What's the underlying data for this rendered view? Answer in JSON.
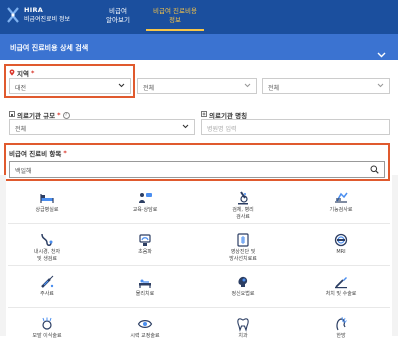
{
  "header": {
    "logo_line1": "HIRA",
    "logo_line2": "비급여진료비 정보",
    "nav": [
      {
        "line1": "비급여",
        "line2": "알아보기"
      },
      {
        "line1": "비급여 진료비용",
        "line2": "정보"
      }
    ]
  },
  "panel": {
    "title": "비급여 진료비용 상세 검색"
  },
  "region": {
    "label": "지역",
    "required": "*",
    "sido": "대전",
    "sigungu": "전체",
    "dong": "전체"
  },
  "facility": {
    "scale_label": "의료기관 규모",
    "required": "*",
    "help": "?",
    "scale_value": "전체",
    "name_label": "의료기관 명칭",
    "name_placeholder": "병원명 입력"
  },
  "item": {
    "label": "비급여 진료비 항목",
    "required": "*",
    "value": "백일해"
  },
  "categories": [
    {
      "label": "상급병실료",
      "icon": "hospital-bed-icon"
    },
    {
      "label": "교육·상담료",
      "icon": "consultation-icon"
    },
    {
      "label": "검체, 병리\n검사료",
      "icon": "microscope-icon"
    },
    {
      "label": "기능검사료",
      "icon": "function-test-icon"
    },
    {
      "label": "내시경, 천자\n및 생검료",
      "icon": "endoscope-icon"
    },
    {
      "label": "초음파",
      "icon": "ultrasound-icon"
    },
    {
      "label": "영상진단 및\n방사선치료료",
      "icon": "radiology-icon"
    },
    {
      "label": "MRI",
      "icon": "mri-icon"
    },
    {
      "label": "주사료",
      "icon": "syringe-icon"
    },
    {
      "label": "물리치료",
      "icon": "physical-therapy-icon"
    },
    {
      "label": "정신요법료",
      "icon": "psychotherapy-icon"
    },
    {
      "label": "처치 및 수술료",
      "icon": "surgery-icon"
    },
    {
      "label": "모발 이식술료",
      "icon": "hair-transplant-icon"
    },
    {
      "label": "시력 교정술료",
      "icon": "eye-icon"
    },
    {
      "label": "치과",
      "icon": "tooth-icon"
    },
    {
      "label": "한방",
      "icon": "acupuncture-icon"
    }
  ],
  "colors": {
    "topbar": "#1b4f9e",
    "panel_head": "#3b73d1",
    "nav_active": "#f7c548",
    "required": "#d9352a",
    "highlight_box": "#e05a2e",
    "icon_primary": "#2c3e63",
    "icon_accent": "#4a8ef0"
  }
}
